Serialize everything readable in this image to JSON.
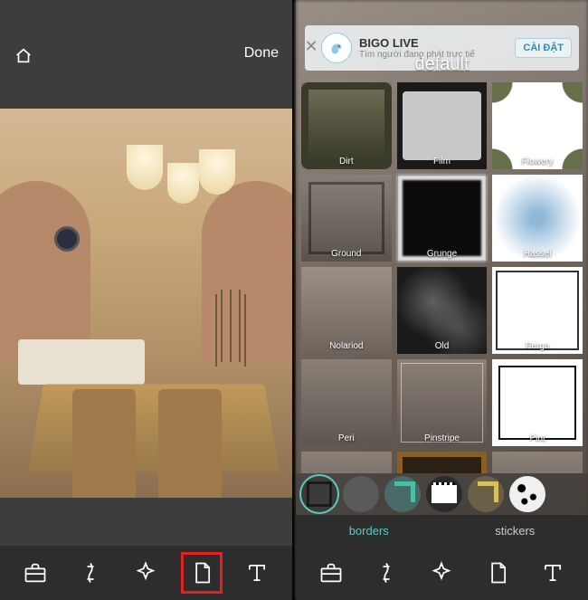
{
  "left": {
    "done_label": "Done",
    "toolbar": [
      "toolbox",
      "brush",
      "effects",
      "borders",
      "text"
    ],
    "highlighted_tool": "borders"
  },
  "right": {
    "ad": {
      "title": "BIGO LIVE",
      "subtitle": "Tìm người đang phát trực tiế",
      "cta": "CÀI ĐẶT"
    },
    "category_title": "default",
    "borders": [
      {
        "name": "Dirt",
        "thumb": "t-dirt"
      },
      {
        "name": "Film",
        "thumb": "t-film"
      },
      {
        "name": "Flowery",
        "thumb": "t-flowery"
      },
      {
        "name": "Ground",
        "thumb": "t-ground"
      },
      {
        "name": "Grunge",
        "thumb": "t-grunge"
      },
      {
        "name": "Hassel",
        "thumb": "t-hassel"
      },
      {
        "name": "Nolariod",
        "thumb": "t-nolariod"
      },
      {
        "name": "Old",
        "thumb": "t-old"
      },
      {
        "name": "Perga",
        "thumb": "t-perga"
      },
      {
        "name": "Peri",
        "thumb": "t-peri"
      },
      {
        "name": "Pinstripe",
        "thumb": "t-pinstripe"
      },
      {
        "name": "Pint",
        "thumb": "t-pint"
      },
      {
        "name": "",
        "thumb": "t-partial"
      },
      {
        "name": "",
        "thumb": "t-burn"
      },
      {
        "name": "",
        "thumb": "t-partial"
      }
    ],
    "style_strip_count": 6,
    "tabs": {
      "borders": "borders",
      "stickers": "stickers",
      "active": "borders"
    },
    "toolbar": [
      "toolbox",
      "brush",
      "effects",
      "borders",
      "text"
    ]
  },
  "icons": {
    "home": "home-icon",
    "done": "done-button",
    "toolbox": "toolbox-icon",
    "brush": "brush-icon",
    "effects": "sparkle-icon",
    "borders": "page-icon",
    "text": "text-icon",
    "close": "close-icon",
    "dino": "dino-icon"
  }
}
